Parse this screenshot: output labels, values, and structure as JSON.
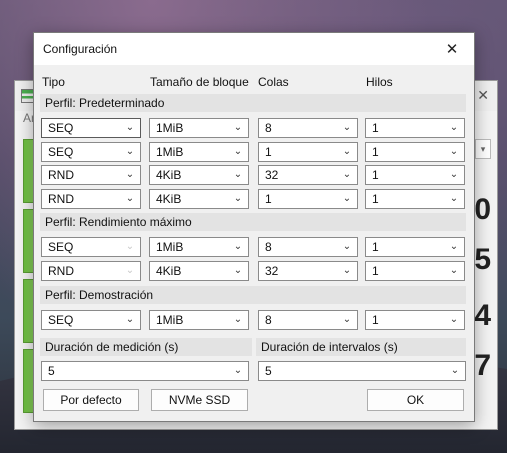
{
  "dialog": {
    "title": "Configuración",
    "close_glyph": "✕"
  },
  "columns": {
    "type": "Tipo",
    "block_size": "Tamaño de bloque",
    "queues": "Colas",
    "threads": "Hilos"
  },
  "profiles": {
    "default": {
      "label": "Perfil: Predeterminado",
      "rows": [
        {
          "type": "SEQ",
          "block": "1MiB",
          "queues": "8",
          "threads": "1"
        },
        {
          "type": "SEQ",
          "block": "1MiB",
          "queues": "1",
          "threads": "1"
        },
        {
          "type": "RND",
          "block": "4KiB",
          "queues": "32",
          "threads": "1"
        },
        {
          "type": "RND",
          "block": "4KiB",
          "queues": "1",
          "threads": "1"
        }
      ]
    },
    "peak": {
      "label": "Perfil: Rendimiento máximo",
      "rows": [
        {
          "type": "SEQ",
          "block": "1MiB",
          "queues": "8",
          "threads": "1"
        },
        {
          "type": "RND",
          "block": "4KiB",
          "queues": "32",
          "threads": "1"
        }
      ]
    },
    "demo": {
      "label": "Perfil: Demostración",
      "rows": [
        {
          "type": "SEQ",
          "block": "1MiB",
          "queues": "8",
          "threads": "1"
        }
      ]
    }
  },
  "measure_duration": {
    "label": "Duración de medición (s)",
    "value": "5"
  },
  "interval_duration": {
    "label": "Duración de intervalos (s)",
    "value": "5"
  },
  "buttons": {
    "defaults": "Por defecto",
    "nvme": "NVMe SSD",
    "ok": "OK"
  },
  "background_app": {
    "menu_hint": "Ar",
    "numbers": [
      "0",
      "5",
      "4",
      "7"
    ]
  },
  "colors": {
    "dialog_bg": "#f0f0f0",
    "profile_header_bg": "#e3e3e3",
    "bar_green": "#6bbf3f"
  }
}
